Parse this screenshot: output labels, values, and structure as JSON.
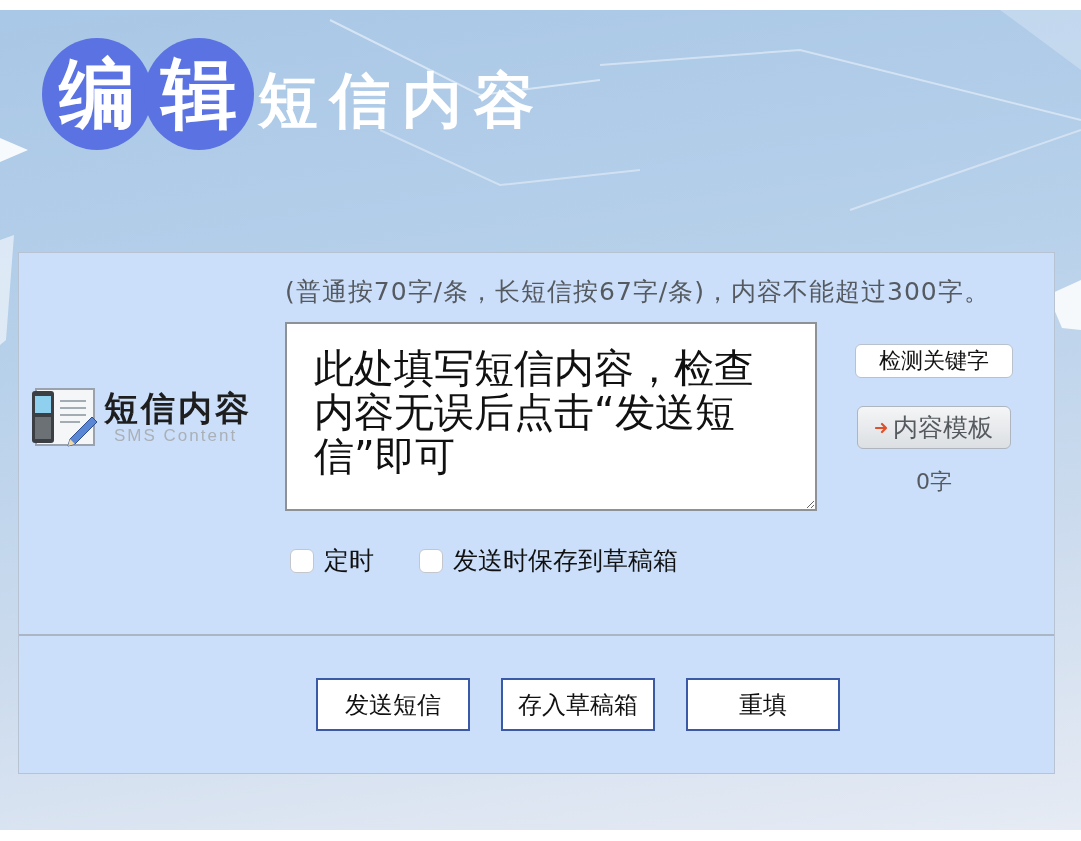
{
  "heading": {
    "highlighted": [
      "编",
      "辑"
    ],
    "text": "短信内容"
  },
  "form": {
    "hint": "(普通按70字/条，长短信按67字/条)，内容不能超过300字。",
    "label": {
      "title": "短信内容",
      "subtitle": "SMS Content"
    },
    "message": {
      "value": "此处填写短信内容，检查内容无误后点击“发送短信”即可"
    },
    "tools": [
      {
        "kind": "plain",
        "label": "检测关键字"
      },
      {
        "kind": "arrow",
        "label": "内容模板"
      }
    ],
    "counter": "0字",
    "options": [
      {
        "label": "定时",
        "checked": false
      },
      {
        "label": "发送时保存到草稿箱",
        "checked": false
      }
    ]
  },
  "buttons": [
    "发送短信",
    "存入草稿箱",
    "重填"
  ]
}
